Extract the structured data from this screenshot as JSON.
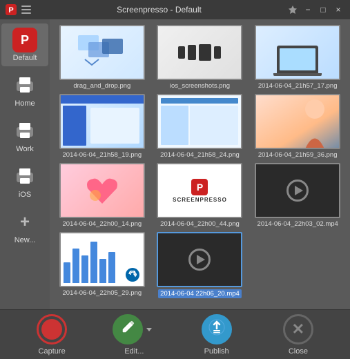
{
  "titleBar": {
    "title": "Screenpresso  -  Default",
    "pinIcon": "📌",
    "minimizeIcon": "−",
    "maximizeIcon": "□",
    "closeIcon": "×"
  },
  "sidebar": {
    "items": [
      {
        "id": "default",
        "label": "Default",
        "active": true
      },
      {
        "id": "home",
        "label": "Home",
        "active": false
      },
      {
        "id": "work",
        "label": "Work",
        "active": false
      },
      {
        "id": "ios",
        "label": "iOS",
        "active": false
      },
      {
        "id": "new",
        "label": "New...",
        "active": false
      }
    ]
  },
  "thumbnails": [
    {
      "id": "thumb1",
      "label": "drag_and_drop.png",
      "selected": false,
      "type": "drag_drop"
    },
    {
      "id": "thumb2",
      "label": "ios_screenshots.png",
      "selected": false,
      "type": "ios"
    },
    {
      "id": "thumb3",
      "label": "2014-06-04_21h57_17.png",
      "selected": false,
      "type": "laptop"
    },
    {
      "id": "thumb4",
      "label": "2014-06-04_21h58_19.png",
      "selected": false,
      "type": "screenshot_blue"
    },
    {
      "id": "thumb5",
      "label": "2014-06-04_21h58_24.png",
      "selected": false,
      "type": "screenshot2"
    },
    {
      "id": "thumb6",
      "label": "2014-06-04_21h59_36.png",
      "selected": false,
      "type": "person"
    },
    {
      "id": "thumb7",
      "label": "2014-06-04_22h00_14.png",
      "selected": false,
      "type": "heart"
    },
    {
      "id": "thumb8",
      "label": "2014-06-04_22h00_44.png",
      "selected": false,
      "type": "screenpresso"
    },
    {
      "id": "thumb9",
      "label": "2014-06-04_22h03_02.mp4",
      "selected": false,
      "type": "video"
    },
    {
      "id": "thumb10",
      "label": "2014-06-04_22h05_29.png",
      "selected": false,
      "type": "chart"
    },
    {
      "id": "thumb11",
      "label": "2014-06-04 22h06_20.mp4",
      "selected": true,
      "type": "video"
    }
  ],
  "toolbar": {
    "captureLabel": "Capture",
    "editLabel": "Edit...",
    "publishLabel": "Publish",
    "closeLabel": "Close"
  }
}
